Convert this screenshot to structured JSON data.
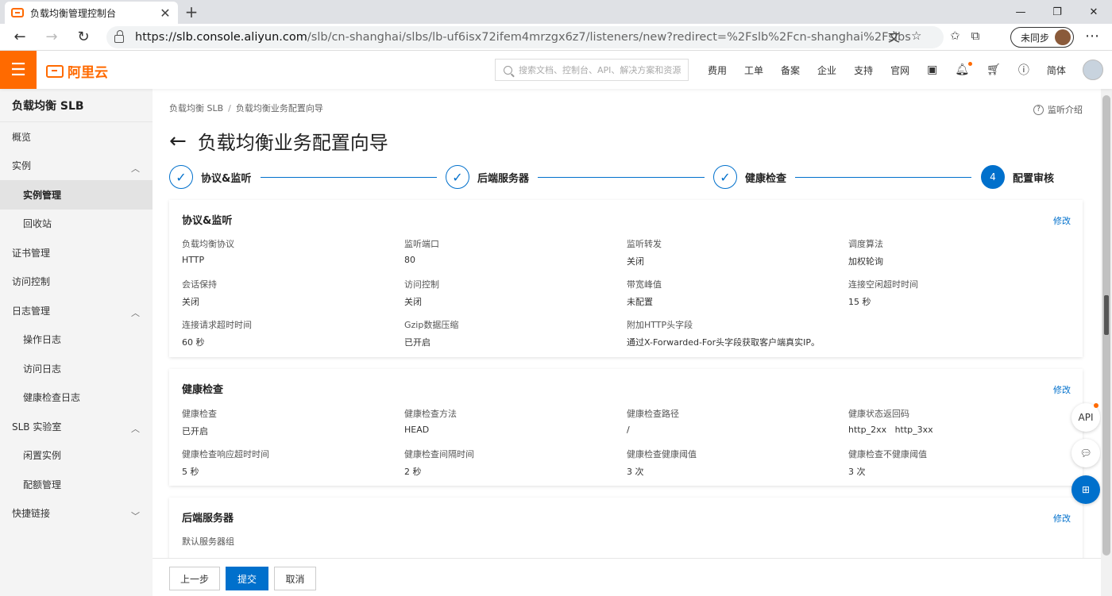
{
  "browser": {
    "tab_title": "负载均衡管理控制台",
    "new_tab": "+",
    "url_host": "slb.console.aliyun.com",
    "url_prefix": "https://",
    "url_path": "/slb/cn-shanghai/slbs/lb-uf6isx72ifem4mrzgx6z7/listeners/new?redirect=%2Fslb%2Fcn-shanghai%2Fslbs",
    "sync_label": "未同步"
  },
  "topbar": {
    "logo_text": "阿里云",
    "search_placeholder": "搜索文档、控制台、API、解决方案和资源",
    "nav": [
      "费用",
      "工单",
      "备案",
      "企业",
      "支持",
      "官网"
    ],
    "lang": "简体"
  },
  "sidebar": {
    "title": "负载均衡 SLB",
    "items": [
      {
        "label": "概览"
      },
      {
        "label": "实例"
      },
      {
        "label": "实例管理"
      },
      {
        "label": "回收站"
      },
      {
        "label": "证书管理"
      },
      {
        "label": "访问控制"
      },
      {
        "label": "日志管理"
      },
      {
        "label": "操作日志"
      },
      {
        "label": "访问日志"
      },
      {
        "label": "健康检查日志"
      },
      {
        "label": "SLB 实验室"
      },
      {
        "label": "闲置实例"
      },
      {
        "label": "配额管理"
      },
      {
        "label": "快捷链接"
      }
    ]
  },
  "breadcrumb": {
    "root": "负载均衡 SLB",
    "sep": "/",
    "current": "负载均衡业务配置向导"
  },
  "help_link": "监听介绍",
  "page_title": "负载均衡业务配置向导",
  "steps": [
    {
      "label": "协议&监听"
    },
    {
      "label": "后端服务器"
    },
    {
      "label": "健康检查"
    },
    {
      "label": "配置审核",
      "number": "4"
    }
  ],
  "listener_card": {
    "title": "协议&监听",
    "edit": "修改",
    "fields": [
      {
        "k": "负载均衡协议",
        "v": "HTTP"
      },
      {
        "k": "监听端口",
        "v": "80"
      },
      {
        "k": "监听转发",
        "v": "关闭"
      },
      {
        "k": "调度算法",
        "v": "加权轮询"
      },
      {
        "k": "会话保持",
        "v": "关闭"
      },
      {
        "k": "访问控制",
        "v": "关闭"
      },
      {
        "k": "带宽峰值",
        "v": "未配置"
      },
      {
        "k": "连接空闲超时时间",
        "v": "15 秒"
      },
      {
        "k": "连接请求超时时间",
        "v": "60 秒"
      },
      {
        "k": "Gzip数据压缩",
        "v": "已开启"
      },
      {
        "k": "附加HTTP头字段",
        "v": "通过X-Forwarded-For头字段获取客户端真实IP。"
      }
    ]
  },
  "health_card": {
    "title": "健康检查",
    "edit": "修改",
    "fields": [
      {
        "k": "健康检查",
        "v": "已开启"
      },
      {
        "k": "健康检查方法",
        "v": "HEAD"
      },
      {
        "k": "健康检查路径",
        "v": "/"
      },
      {
        "k": "健康状态返回码",
        "v": "http_2xx   http_3xx"
      },
      {
        "k": "健康检查响应超时时间",
        "v": "5 秒"
      },
      {
        "k": "健康检查间隔时间",
        "v": "2 秒"
      },
      {
        "k": "健康检查健康阈值",
        "v": "3 次"
      },
      {
        "k": "健康检查不健康阈值",
        "v": "3 次"
      }
    ]
  },
  "backend_card": {
    "title": "后端服务器",
    "edit": "修改",
    "subtitle": "默认服务器组"
  },
  "float_buttons": {
    "api": "API"
  },
  "footer": {
    "prev": "上一步",
    "submit": "提交",
    "cancel": "取消"
  }
}
